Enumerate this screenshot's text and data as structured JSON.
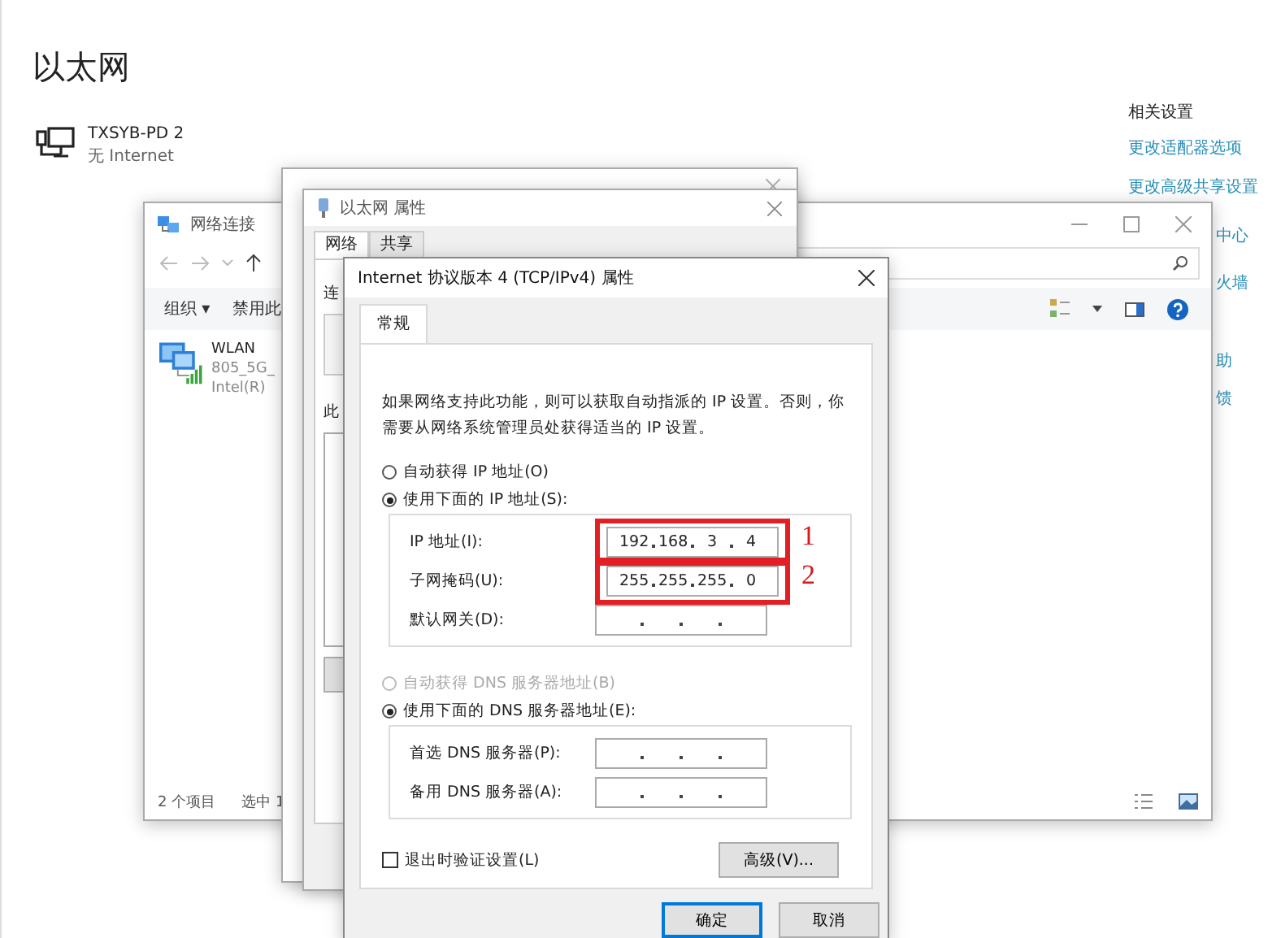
{
  "page": {
    "title": "以太网",
    "adapter": {
      "name": "TXSYB-PD 2",
      "status": "无 Internet"
    }
  },
  "related_settings": {
    "heading": "相关设置",
    "links": [
      {
        "label": "更改适配器选项",
        "cut_left": false
      },
      {
        "label": "更改高级共享设置",
        "cut_left": false
      },
      {
        "label": "中心",
        "cut_left": true
      },
      {
        "label": "火墙",
        "cut_left": true
      },
      {
        "label": "助",
        "cut_left": true
      },
      {
        "label": "馈",
        "cut_left": true
      }
    ]
  },
  "explorer": {
    "title": "网络连接",
    "toolbar": [
      {
        "label": "组织 ▾"
      },
      {
        "label": "禁用此"
      }
    ],
    "items": [
      {
        "name": "WLAN",
        "network": "805_5G_",
        "adapter": "Intel(R)"
      }
    ],
    "status_bar": [
      "2 个项目",
      "选中 1"
    ]
  },
  "properties": {
    "title": "以太网 属性",
    "tabs": [
      {
        "label": "网络",
        "selected": true
      },
      {
        "label": "共享",
        "selected": false
      }
    ],
    "fragments": [
      "连",
      "此"
    ]
  },
  "ipv4": {
    "title": "Internet 协议版本 4 (TCP/IPv4) 属性",
    "tabs": [
      {
        "label": "常规",
        "selected": true
      }
    ],
    "intro": "如果网络支持此功能，则可以获取自动指派的 IP 设置。否则，你需要从网络系统管理员处获得适当的 IP 设置。",
    "ip_options": [
      {
        "label": "自动获得 IP 地址(O)",
        "selected": false,
        "disabled": false
      },
      {
        "label": "使用下面的 IP 地址(S):",
        "selected": true,
        "disabled": false
      }
    ],
    "ip_fields": [
      {
        "label": "IP 地址(I):",
        "octets": [
          "192",
          "168",
          "3",
          "4"
        ],
        "callout": "1"
      },
      {
        "label": "子网掩码(U):",
        "octets": [
          "255",
          "255",
          "255",
          "0"
        ],
        "callout": "2"
      },
      {
        "label": "默认网关(D):"
      }
    ],
    "dns_options": [
      {
        "label": "自动获得 DNS 服务器地址(B)",
        "selected": false,
        "disabled": true
      },
      {
        "label": "使用下面的 DNS 服务器地址(E):",
        "selected": true,
        "disabled": false
      }
    ],
    "dns_fields": [
      {
        "label": "首选 DNS 服务器(P):"
      },
      {
        "label": "备用 DNS 服务器(A):"
      }
    ],
    "validate": {
      "label": "退出时验证设置(L)",
      "checked": false
    },
    "advanced_button": "高级(V)...",
    "buttons": [
      {
        "label": "确定",
        "default": true
      },
      {
        "label": "取消",
        "default": false
      }
    ]
  }
}
